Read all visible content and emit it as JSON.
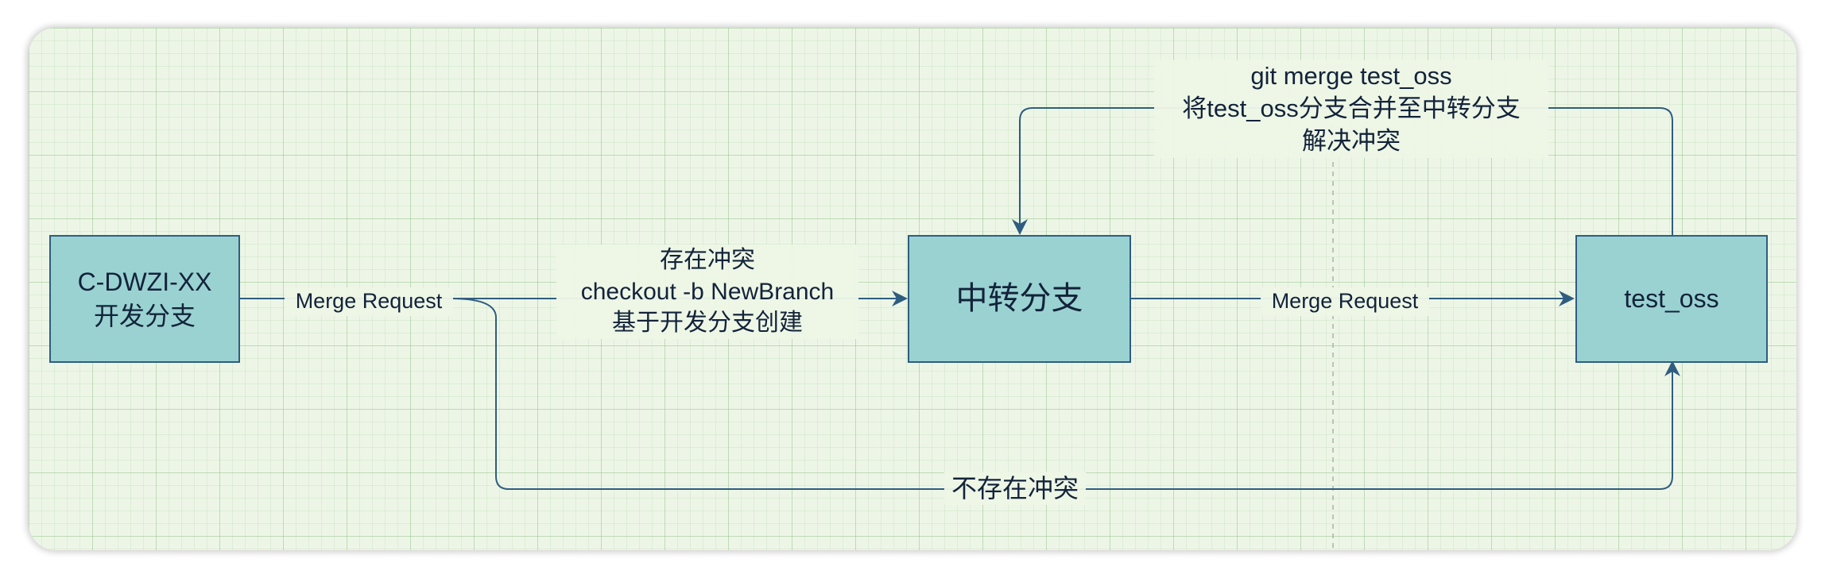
{
  "colors": {
    "canvas_background": "#edf6e6",
    "node_fill": "#9ad2d2",
    "node_border": "#2f5d80",
    "edge_color": "#2f5d80",
    "text_color": "#12233a"
  },
  "nodes": {
    "dev_branch": "C-DWZI-XX\n开发分支",
    "transfer_branch": "中转分支",
    "test_oss": "test_oss"
  },
  "edges": {
    "dev_merge_request": "Merge Request",
    "conflict": "存在冲突\ncheckout  -b  NewBranch\n基于开发分支创建",
    "transfer_merge_request": "Merge Request",
    "no_conflict": "不存在冲突",
    "merge_back": "git merge test_oss\n将test_oss分支合并至中转分支\n解决冲突"
  }
}
